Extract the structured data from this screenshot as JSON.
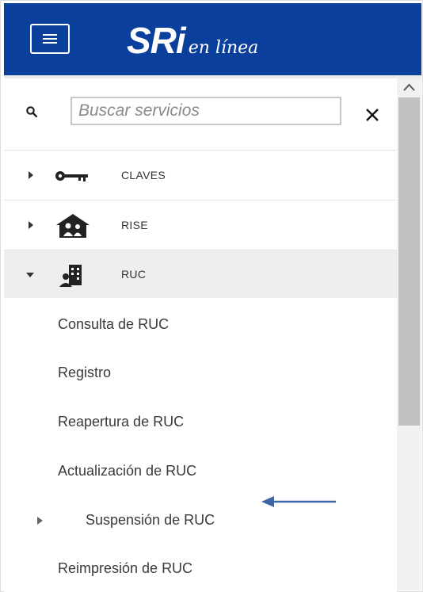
{
  "header": {
    "logo_main": "SRi",
    "logo_sub": "en línea",
    "brand_color": "#0b3f9c"
  },
  "search": {
    "placeholder": "Buscar servicios"
  },
  "menu": [
    {
      "label": "CLAVES",
      "icon": "key-icon",
      "expanded": false
    },
    {
      "label": "RISE",
      "icon": "house-people-icon",
      "expanded": false
    },
    {
      "label": "RUC",
      "icon": "building-person-icon",
      "expanded": true
    }
  ],
  "ruc_submenu": [
    {
      "label": "Consulta de RUC"
    },
    {
      "label": "Registro"
    },
    {
      "label": "Reapertura de RUC"
    },
    {
      "label": "Actualización de RUC"
    },
    {
      "label": "Suspensión de RUC",
      "has_children": true
    },
    {
      "label": "Reimpresión de RUC"
    }
  ],
  "annotation": {
    "color": "#3a66a8",
    "icon": "arrow-left-icon"
  }
}
